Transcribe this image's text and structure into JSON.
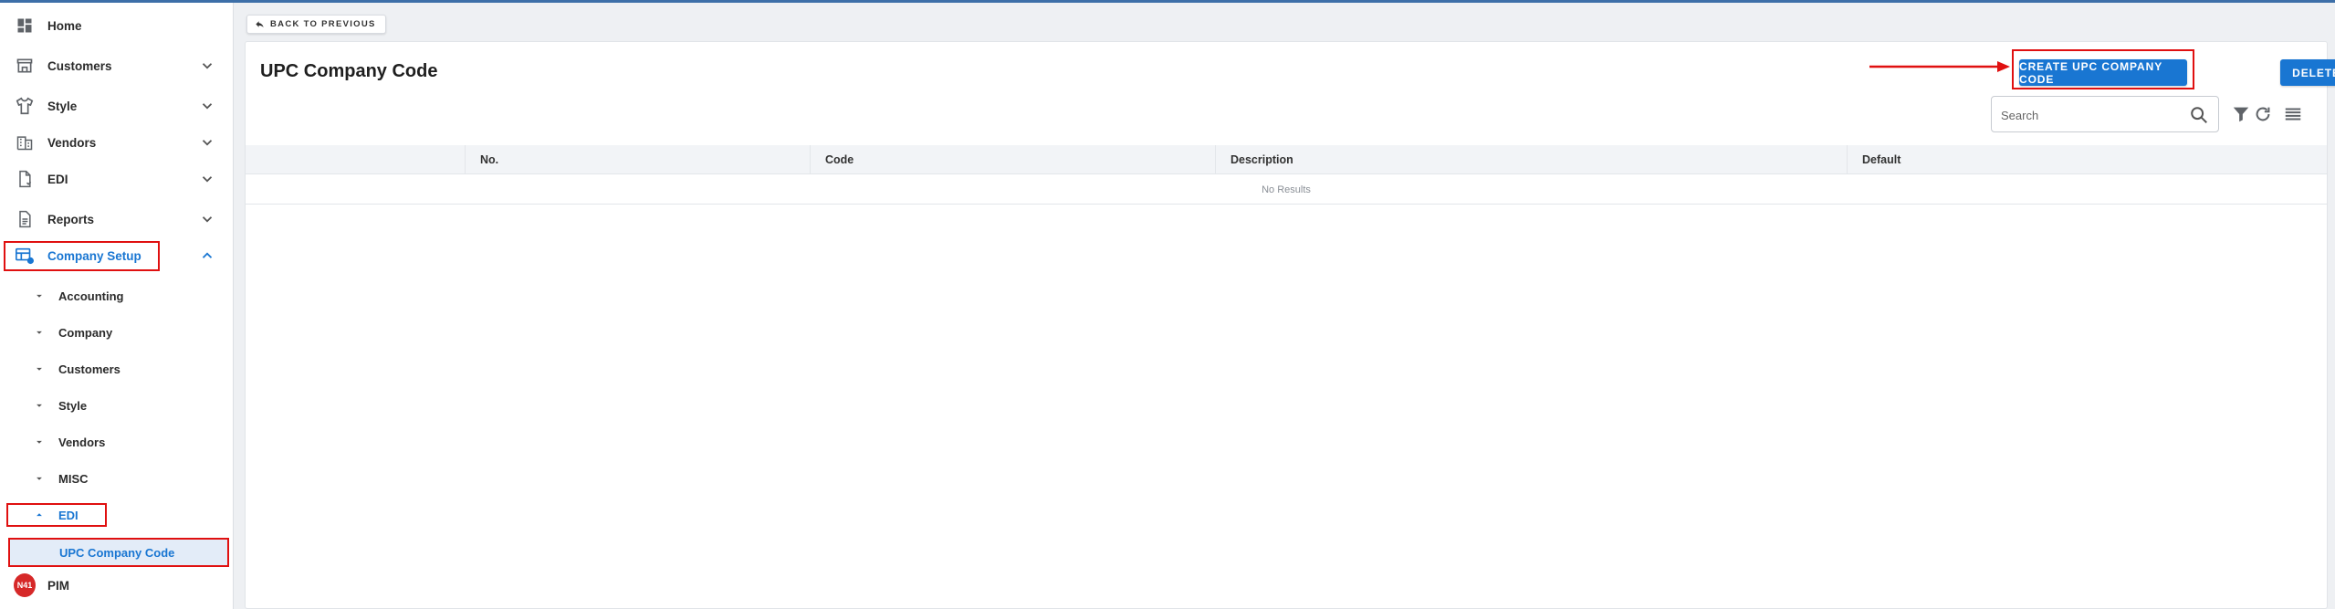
{
  "sidebar": {
    "items": [
      {
        "label": "Home",
        "icon": "dashboard-icon"
      },
      {
        "label": "Customers",
        "icon": "storefront-icon"
      },
      {
        "label": "Style",
        "icon": "shirt-icon"
      },
      {
        "label": "Vendors",
        "icon": "building-icon"
      },
      {
        "label": "EDI",
        "icon": "document-icon"
      },
      {
        "label": "Reports",
        "icon": "report-icon"
      },
      {
        "label": "Company Setup",
        "icon": "company-setup-icon"
      },
      {
        "label": "PIM",
        "icon": "pim-logo-icon"
      }
    ],
    "company_setup_children": [
      {
        "label": "Accounting"
      },
      {
        "label": "Company"
      },
      {
        "label": "Customers"
      },
      {
        "label": "Style"
      },
      {
        "label": "Vendors"
      },
      {
        "label": "MISC"
      },
      {
        "label": "EDI"
      }
    ],
    "edi_children": [
      {
        "label": "UPC Company Code"
      }
    ],
    "pim_logo_text": "N41"
  },
  "back_button": {
    "label": "BACK TO PREVIOUS"
  },
  "main": {
    "title": "UPC Company Code",
    "create_button": "CREATE UPC COMPANY CODE",
    "delete_button": "DELETE",
    "search": {
      "placeholder": "Search",
      "value": ""
    },
    "table": {
      "columns": [
        "No.",
        "Code",
        "Description",
        "Default"
      ],
      "empty_text": "No Results"
    }
  },
  "colors": {
    "accent": "#1976d2",
    "highlight_box": "#e01010",
    "active_row_bg": "#e3ecf8"
  }
}
